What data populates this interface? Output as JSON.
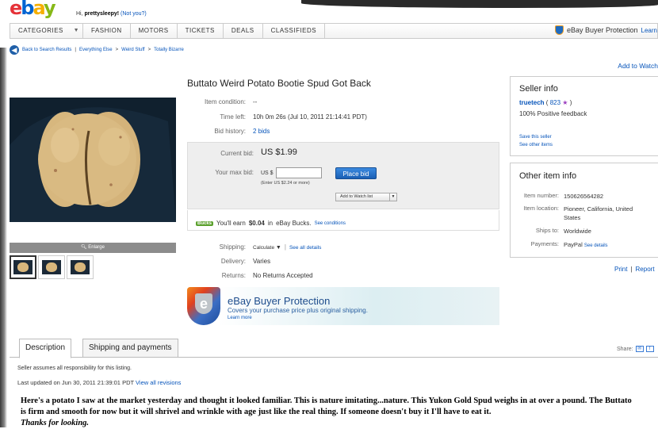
{
  "header": {
    "logo": [
      "e",
      "b",
      "a",
      "y"
    ],
    "greeting_prefix": "Hi,",
    "username": "prettysleepy!",
    "not_you": "(Not you?)"
  },
  "nav": {
    "items": [
      "CATEGORIES",
      "FASHION",
      "MOTORS",
      "TICKETS",
      "DEALS",
      "CLASSIFIEDS"
    ],
    "buyer_protection": "eBay Buyer Protection",
    "learn_more": "Learn"
  },
  "breadcrumb": {
    "back": "Back to Search Results",
    "path": [
      "Everything Else",
      "Weird Stuff",
      "Totally Bizarre"
    ]
  },
  "add_to_watch_top": "Add to Watch",
  "image": {
    "enlarge": "Enlarge",
    "thumbnail_count": 3
  },
  "item": {
    "title": "Buttato Weird Potato Bootie Spud Got Back",
    "condition_label": "Item condition:",
    "condition": "--",
    "time_left_label": "Time left:",
    "time_left": "10h 0m 26s (Jul 10, 2011 21:14:41 PDT)",
    "bid_history_label": "Bid history:",
    "bid_history": "2 bids",
    "current_bid_label": "Current bid:",
    "current_bid": "US $1.99",
    "max_bid_label": "Your max bid:",
    "currency": "US $",
    "bid_input_value": "",
    "bid_hint": "(Enter US $2.24 or more)",
    "place_bid": "Place bid",
    "add_watch_list": "Add to Watch list",
    "bucks_badge": "Bucks",
    "bucks_text_pre": "You'll earn",
    "bucks_amount": "$0.04",
    "bucks_text_mid": "in",
    "bucks_name": "eBay Bucks.",
    "see_conditions": "See conditions",
    "shipping_label": "Shipping:",
    "shipping_value": "Calculate",
    "see_all_details": "See all details",
    "delivery_label": "Delivery:",
    "delivery": "Varies",
    "returns_label": "Returns:",
    "returns": "No Returns Accepted"
  },
  "protection_banner": {
    "title": "eBay Buyer Protection",
    "subtitle": "Covers your purchase price plus original shipping.",
    "learn_more": "Learn more"
  },
  "seller": {
    "heading": "Seller info",
    "name": "truetech",
    "score_open": "(",
    "score": "823",
    "score_close": ")",
    "feedback": "100% Positive feedback",
    "save_seller": "Save this seller",
    "other_items": "See other items"
  },
  "other_info": {
    "heading": "Other item info",
    "rows": [
      {
        "label": "Item number:",
        "value": "150626564282"
      },
      {
        "label": "Item location:",
        "value": "Pioneer, California, United States"
      },
      {
        "label": "Ships to:",
        "value": "Worldwide"
      },
      {
        "label": "Payments:",
        "value": "PayPal",
        "extra": "See details"
      }
    ]
  },
  "print": "Print",
  "report": "Report",
  "tabs": [
    "Description",
    "Shipping and payments"
  ],
  "share_label": "Share:",
  "seller_note": "Seller assumes all responsibility for this listing.",
  "updated_prefix": "Last updated on",
  "updated_date": "Jun 30, 2011 21:39:01 PDT",
  "view_revisions": "View all revisions",
  "description": "Here's a potato I saw at the market yesterday and thought it looked familiar. This is nature imitating...nature. This Yukon Gold Spud weighs in at over a pound. The Buttato is firm and smooth for now but it will shrivel and wrinkle with age just like the real thing. If someone doesn't buy it I'll have to eat it.",
  "description_closing": "Thanks for looking.",
  "colors": {
    "link": "#0654ba",
    "place_bid": "#1a5fb4",
    "bucks": "#5aa02c"
  }
}
